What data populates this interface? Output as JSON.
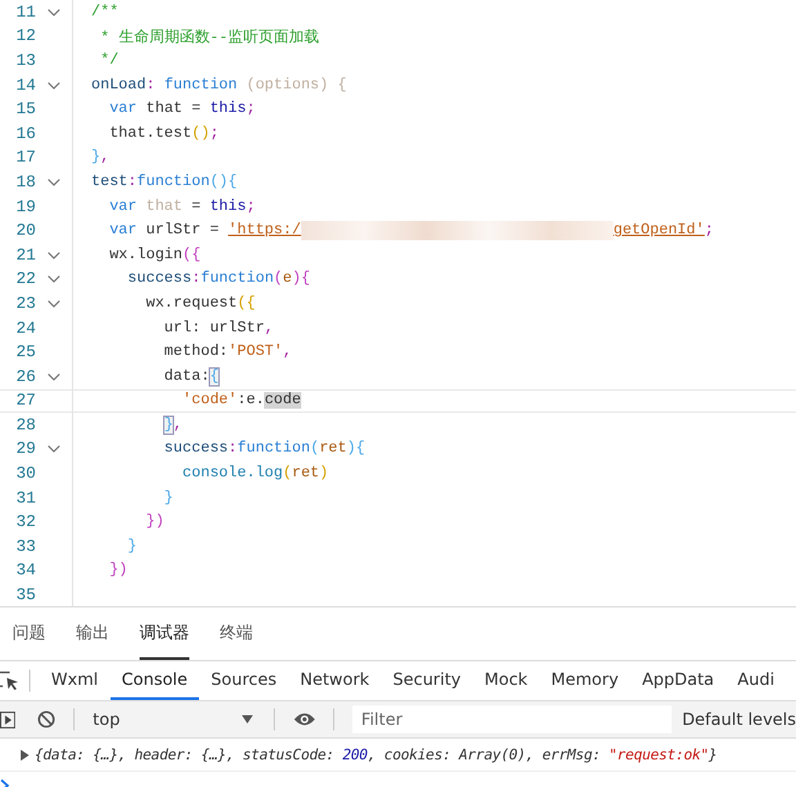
{
  "editor": {
    "lines": [
      {
        "number": "11",
        "foldable": true,
        "current": false,
        "tokens": [
          {
            "text": "/**",
            "kind": "comment"
          }
        ]
      },
      {
        "number": "12",
        "foldable": false,
        "current": false,
        "tokens": [
          {
            "text": " * 生命周期函数--监听页面加载",
            "kind": "comment"
          }
        ]
      },
      {
        "number": "13",
        "foldable": false,
        "current": false,
        "tokens": [
          {
            "text": " */",
            "kind": "comment"
          }
        ]
      },
      {
        "number": "14",
        "foldable": true,
        "current": false,
        "tokens": [
          {
            "text": "onLoad",
            "kind": "prop"
          },
          {
            "text": ": ",
            "kind": "punct"
          },
          {
            "text": "function",
            "kind": "kw"
          },
          {
            "text": " (options) {",
            "kind": "unused"
          }
        ]
      },
      {
        "number": "15",
        "foldable": false,
        "current": false,
        "tokens": [
          {
            "text": "  var",
            "kind": "kw"
          },
          {
            "text": " that = ",
            "kind": "plain"
          },
          {
            "text": "this",
            "kind": "this"
          },
          {
            "text": ";",
            "kind": "punct"
          }
        ]
      },
      {
        "number": "16",
        "foldable": false,
        "current": false,
        "tokens": [
          {
            "text": "  that.test",
            "kind": "plain"
          },
          {
            "text": "()",
            "kind": "b1"
          },
          {
            "text": ";",
            "kind": "punct"
          }
        ]
      },
      {
        "number": "17",
        "foldable": false,
        "current": false,
        "tokens": [
          {
            "text": "}",
            "kind": "b3"
          },
          {
            "text": ",",
            "kind": "punct"
          }
        ]
      },
      {
        "number": "18",
        "foldable": true,
        "current": false,
        "tokens": [
          {
            "text": "test",
            "kind": "prop"
          },
          {
            "text": ":",
            "kind": "punct"
          },
          {
            "text": "function",
            "kind": "kw"
          },
          {
            "text": "(){",
            "kind": "b3"
          }
        ]
      },
      {
        "number": "19",
        "foldable": false,
        "current": false,
        "tokens": [
          {
            "text": "  var ",
            "kind": "kw"
          },
          {
            "text": "that",
            "kind": "unused"
          },
          {
            "text": " = ",
            "kind": "plain"
          },
          {
            "text": "this",
            "kind": "this"
          },
          {
            "text": ";",
            "kind": "punct"
          }
        ]
      },
      {
        "number": "20",
        "foldable": false,
        "current": false,
        "tokens": [
          {
            "text": "  var",
            "kind": "kw"
          },
          {
            "text": " urlStr = ",
            "kind": "plain"
          },
          {
            "text": "'https:/",
            "kind": "url"
          },
          {
            "kind": "redacted"
          },
          {
            "text": "getOpenId'",
            "kind": "url"
          },
          {
            "text": ";",
            "kind": "punct"
          }
        ]
      },
      {
        "number": "21",
        "foldable": true,
        "current": false,
        "tokens": [
          {
            "text": "  wx.login",
            "kind": "plain"
          },
          {
            "text": "({",
            "kind": "b2"
          }
        ]
      },
      {
        "number": "22",
        "foldable": true,
        "current": false,
        "tokens": [
          {
            "text": "    success",
            "kind": "prop"
          },
          {
            "text": ":",
            "kind": "punct"
          },
          {
            "text": "function",
            "kind": "kw"
          },
          {
            "text": "(",
            "kind": "b2"
          },
          {
            "text": "e",
            "kind": "param"
          },
          {
            "text": "){",
            "kind": "b2"
          }
        ]
      },
      {
        "number": "23",
        "foldable": true,
        "current": false,
        "tokens": [
          {
            "text": "      wx.request",
            "kind": "plain"
          },
          {
            "text": "({",
            "kind": "b1"
          }
        ]
      },
      {
        "number": "24",
        "foldable": false,
        "current": false,
        "tokens": [
          {
            "text": "        url: urlStr",
            "kind": "plain"
          },
          {
            "text": ",",
            "kind": "punct"
          }
        ]
      },
      {
        "number": "25",
        "foldable": false,
        "current": false,
        "tokens": [
          {
            "text": "        method:",
            "kind": "plain"
          },
          {
            "text": "'POST'",
            "kind": "string"
          },
          {
            "text": ",",
            "kind": "punct"
          }
        ]
      },
      {
        "number": "26",
        "foldable": true,
        "current": false,
        "tokens": [
          {
            "text": "        data:",
            "kind": "plain"
          },
          {
            "text": "{",
            "kind": "match"
          }
        ]
      },
      {
        "number": "27",
        "foldable": false,
        "current": true,
        "tokens": [
          {
            "text": "          'code'",
            "kind": "string"
          },
          {
            "text": ":e.",
            "kind": "plain"
          },
          {
            "text": "code",
            "kind": "selected"
          }
        ]
      },
      {
        "number": "28",
        "foldable": false,
        "current": false,
        "tokens": [
          {
            "text": "        }",
            "kind": "match"
          },
          {
            "text": ",",
            "kind": "punct"
          }
        ]
      },
      {
        "number": "29",
        "foldable": true,
        "current": false,
        "tokens": [
          {
            "text": "        success",
            "kind": "prop"
          },
          {
            "text": ":",
            "kind": "punct"
          },
          {
            "text": "function",
            "kind": "kw"
          },
          {
            "text": "(",
            "kind": "b3"
          },
          {
            "text": "ret",
            "kind": "param"
          },
          {
            "text": "){",
            "kind": "b3"
          }
        ]
      },
      {
        "number": "30",
        "foldable": false,
        "current": false,
        "tokens": [
          {
            "text": "          console.log",
            "kind": "fn"
          },
          {
            "text": "(",
            "kind": "b1"
          },
          {
            "text": "ret",
            "kind": "param"
          },
          {
            "text": ")",
            "kind": "b1"
          }
        ]
      },
      {
        "number": "31",
        "foldable": false,
        "current": false,
        "tokens": [
          {
            "text": "        }",
            "kind": "b3"
          }
        ]
      },
      {
        "number": "32",
        "foldable": false,
        "current": false,
        "tokens": [
          {
            "text": "      })",
            "kind": "b2"
          }
        ]
      },
      {
        "number": "33",
        "foldable": false,
        "current": false,
        "tokens": [
          {
            "text": "    }",
            "kind": "b3"
          }
        ]
      },
      {
        "number": "34",
        "foldable": false,
        "current": false,
        "tokens": [
          {
            "text": "  })",
            "kind": "b2"
          }
        ]
      },
      {
        "number": "35",
        "foldable": false,
        "current": false
      }
    ]
  },
  "panel_tabs": [
    {
      "label": "问题",
      "selected": false
    },
    {
      "label": "输出",
      "selected": false
    },
    {
      "label": "调试器",
      "selected": true
    },
    {
      "label": "终端",
      "selected": false
    }
  ],
  "devtools_tabs": [
    {
      "label": "Wxml",
      "selected": false
    },
    {
      "label": "Console",
      "selected": true
    },
    {
      "label": "Sources",
      "selected": false
    },
    {
      "label": "Network",
      "selected": false
    },
    {
      "label": "Security",
      "selected": false
    },
    {
      "label": "Mock",
      "selected": false
    },
    {
      "label": "Memory",
      "selected": false
    },
    {
      "label": "AppData",
      "selected": false
    },
    {
      "label": "Audi",
      "selected": false
    }
  ],
  "console_toolbar": {
    "context": "top",
    "filter_placeholder": "Filter",
    "levels": "Default levels"
  },
  "log": {
    "parts": [
      {
        "text": "{data: {…}, header: {…}, statusCode: ",
        "kind": "plain"
      },
      {
        "text": "200",
        "kind": "number"
      },
      {
        "text": ", cookies: Array(0), errMsg: ",
        "kind": "plain"
      },
      {
        "text": "\"request:ok\"",
        "kind": "string"
      },
      {
        "text": "}",
        "kind": "plain"
      }
    ]
  }
}
